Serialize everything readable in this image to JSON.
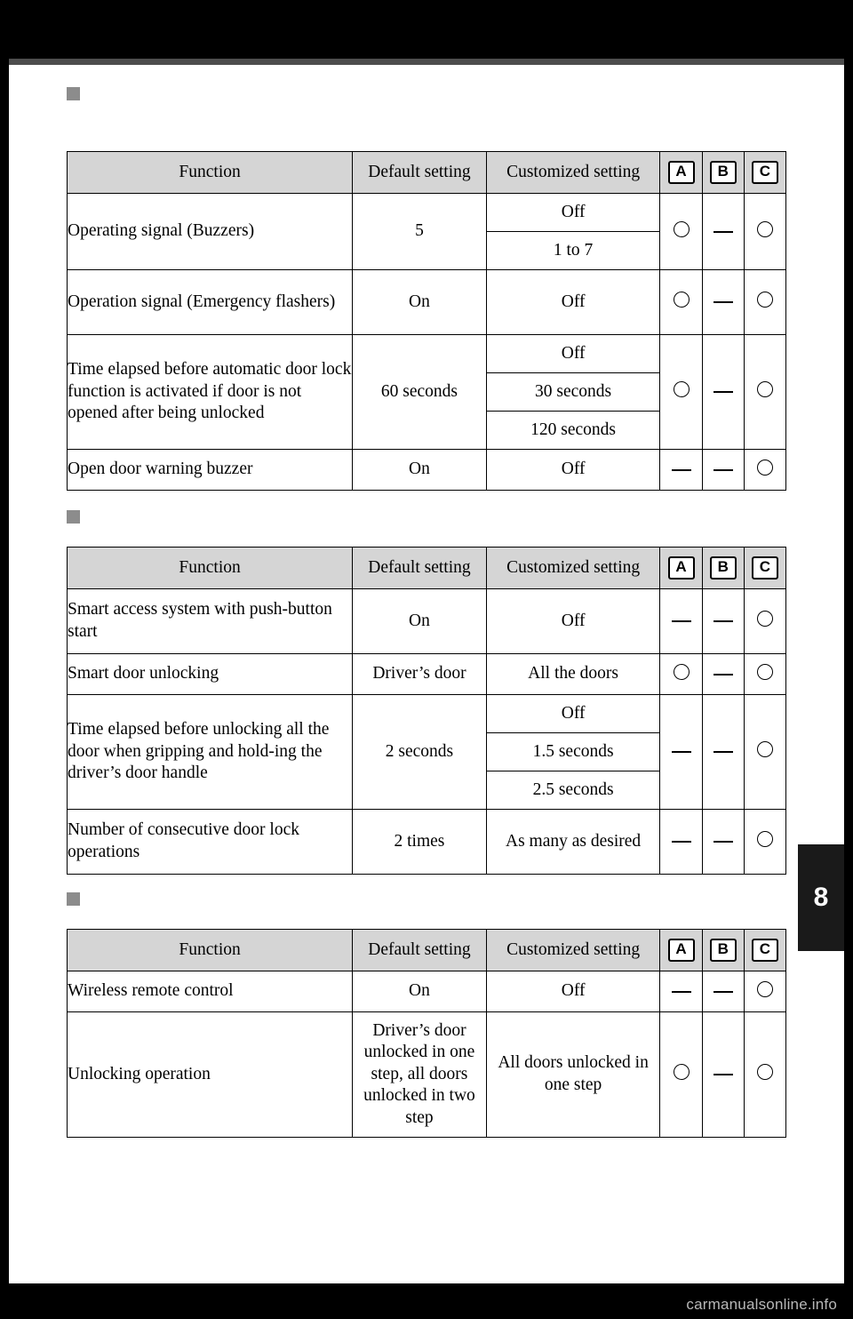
{
  "page": {
    "side_tab_number": "8",
    "watermark": "carmanualsonline.info"
  },
  "tables": [
    {
      "id": "table-1",
      "headers": [
        "Function",
        "Default setting",
        "Customized setting",
        "A",
        "B",
        "C"
      ],
      "rows": [
        {
          "function": "Operating signal (Buzzers)",
          "default": "5",
          "customized": [
            "Off",
            "1 to 7"
          ],
          "a": "circle",
          "b": "dash",
          "c": "circle"
        },
        {
          "function": "Operation signal (Emergency flashers)",
          "default": "On",
          "customized": [
            "Off"
          ],
          "a": "circle",
          "b": "dash",
          "c": "circle"
        },
        {
          "function": "Time elapsed before automatic door lock function is activated if door is not opened after being unlocked",
          "default": "60 seconds",
          "customized": [
            "Off",
            "30 seconds",
            "120 seconds"
          ],
          "a": "circle",
          "b": "dash",
          "c": "circle"
        },
        {
          "function": "Open door warning buzzer",
          "default": "On",
          "customized": [
            "Off"
          ],
          "a": "dash",
          "b": "dash",
          "c": "circle"
        }
      ]
    },
    {
      "id": "table-2",
      "headers": [
        "Function",
        "Default setting",
        "Customized setting",
        "A",
        "B",
        "C"
      ],
      "rows": [
        {
          "function": "Smart access system with push-button start",
          "default": "On",
          "customized": [
            "Off"
          ],
          "a": "dash",
          "b": "dash",
          "c": "circle"
        },
        {
          "function": "Smart door unlocking",
          "default": "Driver’s door",
          "customized": [
            "All the doors"
          ],
          "a": "circle",
          "b": "dash",
          "c": "circle"
        },
        {
          "function": "Time elapsed before unlocking all the door when gripping and hold-ing the driver’s door handle",
          "default": "2 seconds",
          "customized": [
            "Off",
            "1.5 seconds",
            "2.5 seconds"
          ],
          "a": "dash",
          "b": "dash",
          "c": "circle"
        },
        {
          "function": "Number of consecutive door lock operations",
          "default": "2 times",
          "customized": [
            "As many as desired"
          ],
          "a": "dash",
          "b": "dash",
          "c": "circle"
        }
      ]
    },
    {
      "id": "table-3",
      "headers": [
        "Function",
        "Default setting",
        "Customized setting",
        "A",
        "B",
        "C"
      ],
      "rows": [
        {
          "function": "Wireless remote control",
          "default": "On",
          "customized": [
            "Off"
          ],
          "a": "dash",
          "b": "dash",
          "c": "circle"
        },
        {
          "function": "Unlocking operation",
          "default": "Driver’s door unlocked in one step, all doors unlocked in two step",
          "customized": [
            "All doors unlocked in one step"
          ],
          "a": "circle",
          "b": "dash",
          "c": "circle"
        }
      ]
    }
  ]
}
